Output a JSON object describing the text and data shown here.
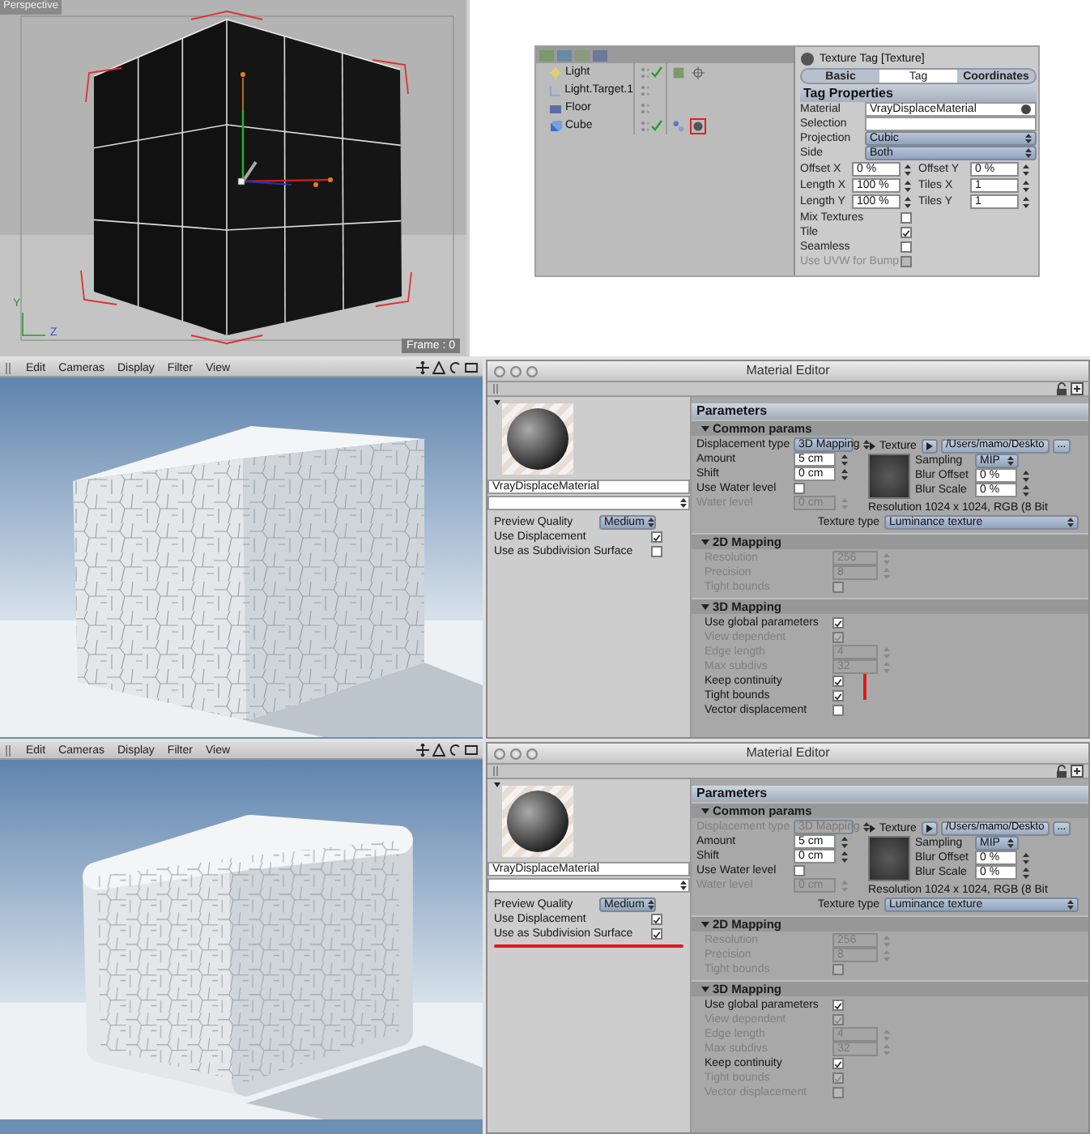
{
  "top_viewport": {
    "label": "Perspective",
    "frame": "Frame : 0",
    "axis_labels": [
      "Y",
      "Z"
    ]
  },
  "object_manager": {
    "objects": [
      {
        "name": "Light",
        "kind": "light",
        "enabled": true,
        "tags": [
          {
            "kind": "texture",
            "selected": false
          },
          {
            "kind": "target",
            "selected": false
          }
        ]
      },
      {
        "name": "Light.Target.1",
        "kind": "target",
        "enabled": false
      },
      {
        "name": "Floor",
        "kind": "floor",
        "enabled": false
      },
      {
        "name": "Cube",
        "kind": "cube",
        "enabled": true,
        "tags": [
          {
            "kind": "phong",
            "selected": false
          },
          {
            "kind": "material",
            "selected": true
          }
        ]
      }
    ]
  },
  "texture_tag": {
    "title": "Texture Tag [Texture]",
    "tabs": [
      {
        "label": "Basic",
        "selected": false
      },
      {
        "label": "Tag",
        "selected": true
      },
      {
        "label": "Coordinates",
        "selected": false
      }
    ],
    "section": "Tag Properties",
    "material": {
      "label": "Material",
      "value": "VrayDisplaceMaterial"
    },
    "selection": {
      "label": "Selection"
    },
    "dropdowns": [
      {
        "label": "Projection",
        "value": "Cubic"
      },
      {
        "label": "Side",
        "value": "Both"
      }
    ],
    "grid": [
      {
        "label": "Offset X",
        "value": "0 %"
      },
      {
        "label": "Offset Y",
        "value": "0 %"
      },
      {
        "label": "Length X",
        "value": "100 %"
      },
      {
        "label": "Tiles X",
        "value": "1"
      },
      {
        "label": "Length Y",
        "value": "100 %"
      },
      {
        "label": "Tiles Y",
        "value": "1"
      }
    ],
    "checkboxes": [
      {
        "label": "Mix Textures",
        "checked": false,
        "disabled": false
      },
      {
        "label": "Tile",
        "checked": true,
        "disabled": false
      },
      {
        "label": "Seamless",
        "checked": false,
        "disabled": false
      },
      {
        "label": "Use UVW for Bump",
        "checked": false,
        "disabled": true
      }
    ]
  },
  "views": [
    {
      "menu": [
        "Edit",
        "Cameras",
        "Display",
        "Filter",
        "View"
      ],
      "render": {
        "smooth": false
      },
      "editor": {
        "title": "Material Editor",
        "material_name": "VrayDisplaceMaterial",
        "options": [
          {
            "kind": "select",
            "label": "Preview Quality",
            "value": "Medium",
            "marked": false
          },
          {
            "kind": "checkbox",
            "label": "Use Displacement",
            "checked": true,
            "marked": false
          },
          {
            "kind": "checkbox",
            "label": "Use as Subdivision Surface",
            "checked": false,
            "marked": false
          }
        ],
        "parameters_title": "Parameters",
        "common": {
          "title": "Common params",
          "rows": [
            {
              "kind": "select",
              "label": "Displacement type",
              "value": "3D Mapping",
              "disabled": false
            },
            {
              "kind": "number",
              "label": "Amount",
              "value": "5 cm",
              "disabled": false
            },
            {
              "kind": "number",
              "label": "Shift",
              "value": "0 cm",
              "disabled": false
            },
            {
              "kind": "checkbox",
              "label": "Use Water level",
              "checked": false,
              "disabled": false
            },
            {
              "kind": "number",
              "label": "Water level",
              "value": "0 cm",
              "disabled": true
            }
          ],
          "texture": {
            "label": "Texture",
            "path": "/Users/mamo/Deskto",
            "browse": "...",
            "fields": [
              {
                "kind": "select",
                "label": "Sampling",
                "value": "MIP",
                "disabled": false
              },
              {
                "kind": "number",
                "label": "Blur Offset",
                "value": "0 %",
                "disabled": false
              },
              {
                "kind": "number",
                "label": "Blur Scale",
                "value": "0 %",
                "disabled": false
              }
            ],
            "resolution": "Resolution 1024 x 1024, RGB (8 Bit",
            "type": {
              "label": "Texture type",
              "value": "Luminance texture"
            }
          }
        },
        "sections": [
          {
            "title": "2D Mapping",
            "rows": [
              {
                "kind": "number",
                "label": "Resolution",
                "value": "256",
                "disabled": true
              },
              {
                "kind": "number",
                "label": "Precision",
                "value": "8",
                "disabled": true
              },
              {
                "kind": "checkbox",
                "label": "Tight bounds",
                "checked": false,
                "disabled": true
              }
            ]
          },
          {
            "title": "3D Mapping",
            "rows": [
              {
                "kind": "checkbox",
                "label": "Use global parameters",
                "checked": true,
                "disabled": false
              },
              {
                "kind": "checkbox",
                "label": "View dependent",
                "checked": true,
                "disabled": true
              },
              {
                "kind": "number",
                "label": "Edge length",
                "value": "4",
                "disabled": true
              },
              {
                "kind": "number",
                "label": "Max subdivs",
                "value": "32",
                "disabled": true
              },
              {
                "kind": "checkbox",
                "label": "Keep continuity",
                "checked": true,
                "disabled": false,
                "marked": true
              },
              {
                "kind": "checkbox",
                "label": "Tight bounds",
                "checked": true,
                "disabled": false
              },
              {
                "kind": "checkbox",
                "label": "Vector displacement",
                "checked": false,
                "disabled": false
              }
            ]
          }
        ]
      }
    },
    {
      "menu": [
        "Edit",
        "Cameras",
        "Display",
        "Filter",
        "View"
      ],
      "render": {
        "smooth": true
      },
      "editor": {
        "title": "Material Editor",
        "material_name": "VrayDisplaceMaterial",
        "options": [
          {
            "kind": "select",
            "label": "Preview Quality",
            "value": "Medium",
            "marked": false
          },
          {
            "kind": "checkbox",
            "label": "Use Displacement",
            "checked": true,
            "marked": false
          },
          {
            "kind": "checkbox",
            "label": "Use as Subdivision Surface",
            "checked": true,
            "marked": true
          }
        ],
        "parameters_title": "Parameters",
        "common": {
          "title": "Common params",
          "rows": [
            {
              "kind": "select",
              "label": "Displacement type",
              "value": "3D Mapping",
              "disabled": true
            },
            {
              "kind": "number",
              "label": "Amount",
              "value": "5 cm",
              "disabled": false
            },
            {
              "kind": "number",
              "label": "Shift",
              "value": "0 cm",
              "disabled": false
            },
            {
              "kind": "checkbox",
              "label": "Use Water level",
              "checked": false,
              "disabled": false
            },
            {
              "kind": "number",
              "label": "Water level",
              "value": "0 cm",
              "disabled": true
            }
          ],
          "texture": {
            "label": "Texture",
            "path": "/Users/mamo/Deskto",
            "browse": "...",
            "fields": [
              {
                "kind": "select",
                "label": "Sampling",
                "value": "MIP",
                "disabled": false
              },
              {
                "kind": "number",
                "label": "Blur Offset",
                "value": "0 %",
                "disabled": false
              },
              {
                "kind": "number",
                "label": "Blur Scale",
                "value": "0 %",
                "disabled": false
              }
            ],
            "resolution": "Resolution 1024 x 1024, RGB (8 Bit",
            "type": {
              "label": "Texture type",
              "value": "Luminance texture"
            }
          }
        },
        "sections": [
          {
            "title": "2D Mapping",
            "rows": [
              {
                "kind": "number",
                "label": "Resolution",
                "value": "256",
                "disabled": true
              },
              {
                "kind": "number",
                "label": "Precision",
                "value": "8",
                "disabled": true
              },
              {
                "kind": "checkbox",
                "label": "Tight bounds",
                "checked": false,
                "disabled": true
              }
            ]
          },
          {
            "title": "3D Mapping",
            "rows": [
              {
                "kind": "checkbox",
                "label": "Use global parameters",
                "checked": true,
                "disabled": false
              },
              {
                "kind": "checkbox",
                "label": "View dependent",
                "checked": true,
                "disabled": true
              },
              {
                "kind": "number",
                "label": "Edge length",
                "value": "4",
                "disabled": true
              },
              {
                "kind": "number",
                "label": "Max subdivs",
                "value": "32",
                "disabled": true
              },
              {
                "kind": "checkbox",
                "label": "Keep continuity",
                "checked": true,
                "disabled": false,
                "marked": false
              },
              {
                "kind": "checkbox",
                "label": "Tight bounds",
                "checked": true,
                "disabled": true
              },
              {
                "kind": "checkbox",
                "label": "Vector displacement",
                "checked": false,
                "disabled": true
              }
            ]
          }
        ]
      }
    }
  ]
}
